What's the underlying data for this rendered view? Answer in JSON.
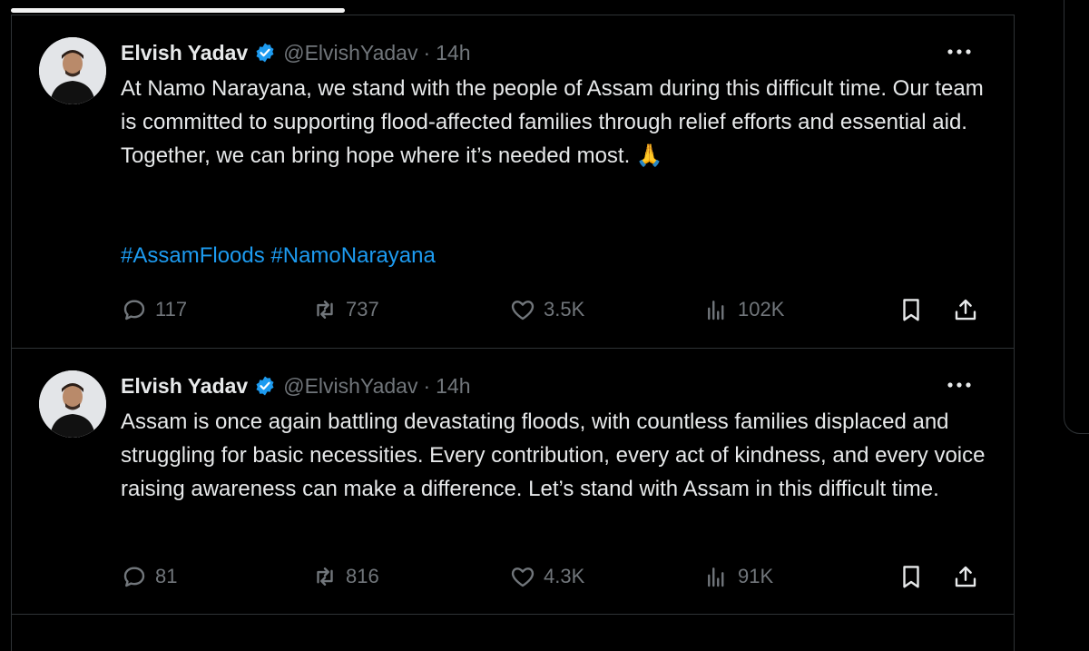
{
  "tweets": [
    {
      "author": {
        "name": "Elvish Yadav",
        "handle": "@ElvishYadav",
        "time": "14h",
        "separator": "·"
      },
      "text": "At Namo Narayana, we stand with the people of Assam during this difficult time. Our team is committed to supporting flood-affected families through relief efforts and essential aid. Together, we can bring hope where it’s needed most. 🙏",
      "hashtags": [
        "#AssamFloods",
        "#NamoNarayana"
      ],
      "stats": {
        "replies": "117",
        "reposts": "737",
        "likes": "3.5K",
        "views": "102K"
      }
    },
    {
      "author": {
        "name": "Elvish Yadav",
        "handle": "@ElvishYadav",
        "time": "14h",
        "separator": "·"
      },
      "text": "Assam is once again battling devastating floods, with countless families displaced and struggling for basic necessities. Every contribution, every act of kindness, and every voice raising awareness can make a difference. Let’s stand with Assam in this difficult time.",
      "stats": {
        "replies": "81",
        "reposts": "816",
        "likes": "4.3K",
        "views": "91K"
      }
    }
  ],
  "colors": {
    "background": "#000000",
    "text": "#e7e9ea",
    "secondary": "#71767b",
    "link": "#1d9bf0",
    "verified": "#1d9bf0",
    "divider": "#2f3336"
  },
  "icons": [
    "verified-badge-icon",
    "more-options-icon",
    "reply-icon",
    "repost-icon",
    "like-icon",
    "views-icon",
    "bookmark-icon",
    "share-icon"
  ]
}
